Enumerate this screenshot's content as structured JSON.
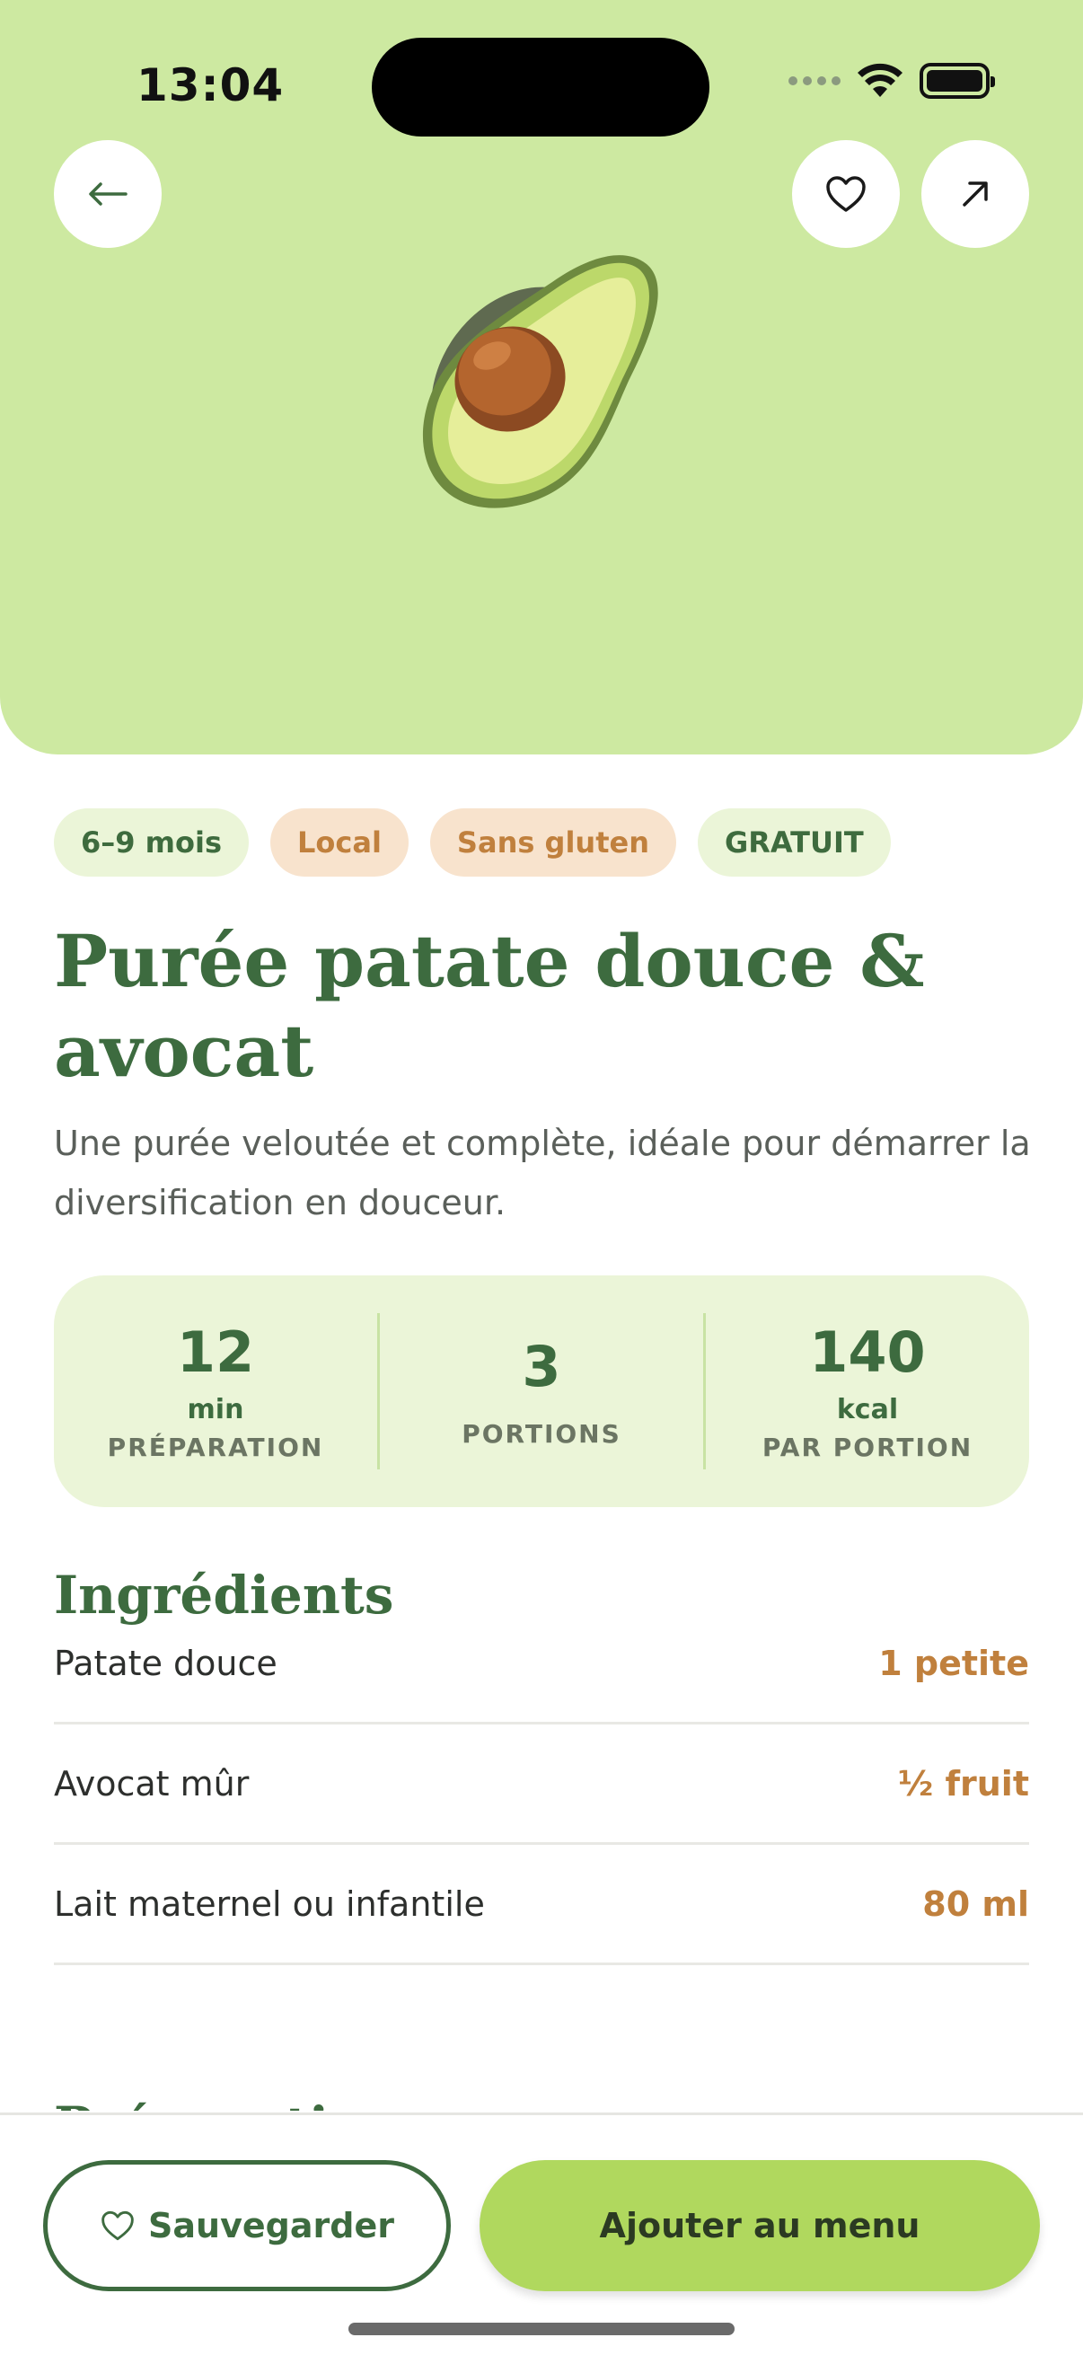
{
  "status_bar": {
    "time": "13:04"
  },
  "hero": {
    "background": "#cde9a1",
    "image": "avocado-half"
  },
  "actions": {
    "back_icon": "arrow-left-icon",
    "favorite_icon": "heart-icon",
    "share_icon": "arrow-up-right-icon"
  },
  "tags": [
    {
      "label": "6–9 mois",
      "style": "green"
    },
    {
      "label": "Local",
      "style": "orange"
    },
    {
      "label": "Sans gluten",
      "style": "orange"
    },
    {
      "label": "GRATUIT",
      "style": "green"
    }
  ],
  "recipe": {
    "title": "Purée patate douce & avocat",
    "description": "Une purée veloutée et complète, idéale pour démarrer la diversification en douceur."
  },
  "stats": [
    {
      "value": "12",
      "unit": "min",
      "label": "PRÉPARATION"
    },
    {
      "value": "3",
      "unit": "",
      "label": "PORTIONS"
    },
    {
      "value": "140",
      "unit": "kcal",
      "label": "PAR PORTION"
    }
  ],
  "ingredients": {
    "title": "Ingrédients",
    "items": [
      {
        "name": "Patate douce",
        "qty": "1 petite"
      },
      {
        "name": "Avocat mûr",
        "qty": "½ fruit"
      },
      {
        "name": "Lait maternel ou infantile",
        "qty": "80 ml"
      }
    ]
  },
  "preparation": {
    "title": "Préparation"
  },
  "bottom": {
    "save_label": "Sauvegarder",
    "add_label": "Ajouter au menu"
  },
  "colors": {
    "primary_green": "#3d6b3f",
    "accent_orange": "#c0803d",
    "button_lime": "#b0d85e"
  }
}
